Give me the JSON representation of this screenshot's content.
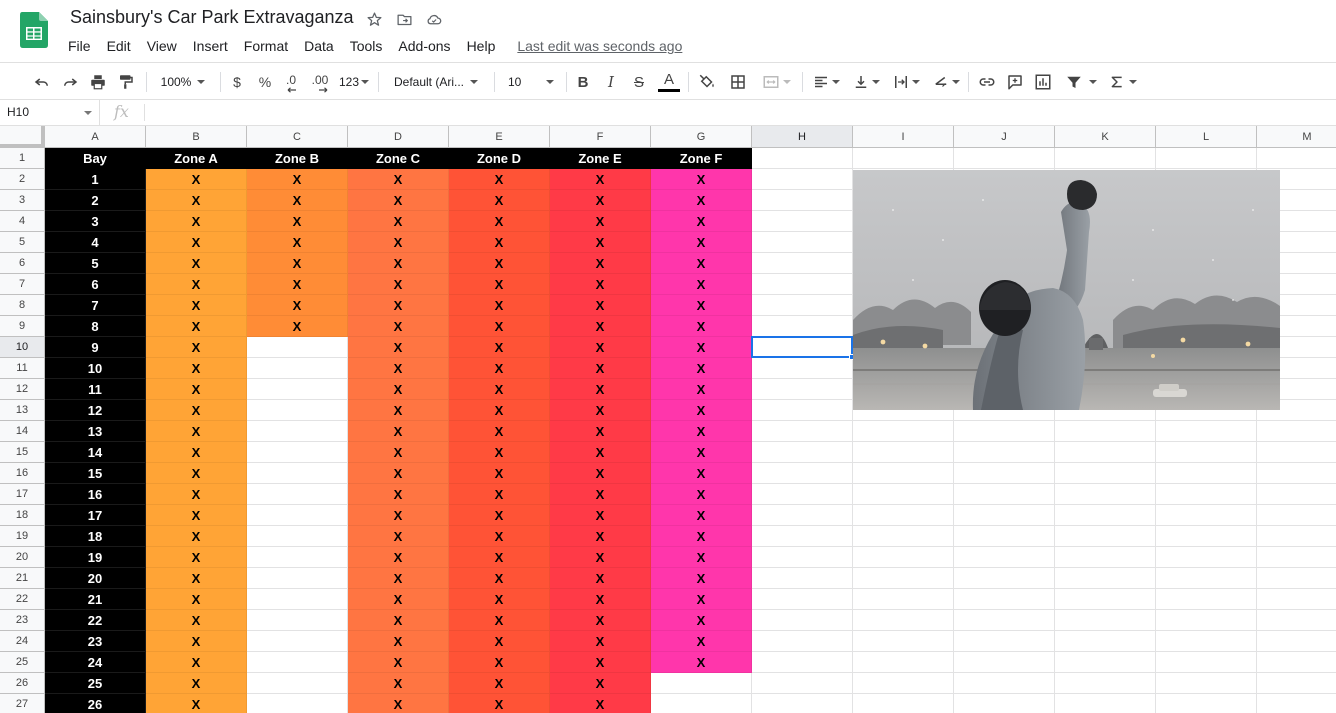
{
  "doc": {
    "title": "Sainsbury's Car Park Extravaganza",
    "last_edit": "Last edit was seconds ago"
  },
  "menu": [
    "File",
    "Edit",
    "View",
    "Insert",
    "Format",
    "Data",
    "Tools",
    "Add-ons",
    "Help"
  ],
  "toolbar": {
    "zoom": "100%",
    "currency": "$",
    "percent": "%",
    "decrease_decimal": ".0",
    "increase_decimal": ".00",
    "more_formats": "123",
    "font": "Default (Ari...",
    "font_size": "10",
    "bold": "B",
    "italic": "I",
    "strikethrough": "S",
    "text_color_letter": "A"
  },
  "formula_bar": {
    "cell_ref": "H10",
    "fx": "fx",
    "value": ""
  },
  "sheet": {
    "columns": [
      "A",
      "B",
      "C",
      "D",
      "E",
      "F",
      "G",
      "H",
      "I",
      "J",
      "K",
      "L",
      "M"
    ],
    "selected_column": "H",
    "selected_row": 10,
    "header_row": [
      "Bay",
      "Zone A",
      "Zone B",
      "Zone C",
      "Zone D",
      "Zone E",
      "Zone F"
    ],
    "bays": [
      "1",
      "2",
      "3",
      "4",
      "5",
      "6",
      "7",
      "8",
      "9",
      "10",
      "11",
      "12",
      "13",
      "14",
      "15",
      "16",
      "17",
      "18",
      "19",
      "20",
      "21",
      "22",
      "23",
      "24",
      "25",
      "26"
    ],
    "mark": "X",
    "zone_colors": {
      "Zone A": "#ffa436",
      "Zone B": "#ff8c36",
      "Zone C": "#ff7542",
      "Zone D": "#ff5336",
      "Zone E": "#ff3a47",
      "Zone F": "#ff36ab"
    },
    "zone_bay_counts": {
      "Zone A": 26,
      "Zone B": 8,
      "Zone C": 26,
      "Zone D": 26,
      "Zone E": 26,
      "Zone F": 24
    },
    "header_color": "#000000"
  },
  "colors": {
    "selection": "#1a73e8",
    "sheets_green": "#23a566"
  }
}
